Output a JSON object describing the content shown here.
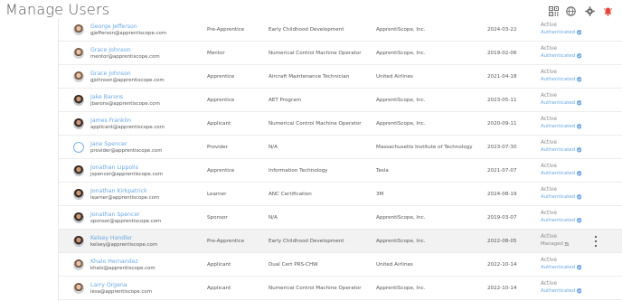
{
  "header": {
    "title": "Manage Users",
    "icons": [
      "qr-code-icon",
      "globe-icon",
      "gear-icon",
      "alarm-bell-icon"
    ],
    "alert_color": "#e5473b"
  },
  "colors": {
    "link": "#6aa8e3",
    "text": "#555555",
    "muted": "#8a8a8a",
    "row_highlight": "#f2f2f2"
  },
  "users": [
    {
      "name": "George Jefferson",
      "email": "gjefferson@apprentiscope.com",
      "role": "Pre-Apprentice",
      "occupation": "Early Childhood Development",
      "organization": "ApprentiScope, Inc.",
      "date": "2024-03-22",
      "status": "Active",
      "auth": "Authenticated",
      "avatar": "photo"
    },
    {
      "name": "Grace Johnson",
      "email": "mentor@apprentiscope.com",
      "role": "Mentor",
      "occupation": "Numerical Control Machine Operator",
      "organization": "ApprentiScope, Inc.",
      "date": "2019-02-06",
      "status": "Active",
      "auth": "Authenticated",
      "avatar": "photo"
    },
    {
      "name": "Grace Johnson",
      "email": "gjohnson@apprentiscope.com",
      "role": "Apprentice",
      "occupation": "Aircraft Maintenance Technician",
      "organization": "United Airlines",
      "date": "2021-04-18",
      "status": "Active",
      "auth": "Authenticated",
      "avatar": "photo"
    },
    {
      "name": "Jake Barons",
      "email": "jbarons@apprentiscope.com",
      "role": "Apprentice",
      "occupation": "AET Program",
      "organization": "ApprentiScope, Inc.",
      "date": "2023-05-11",
      "status": "Active",
      "auth": "Authenticated",
      "avatar": "photo-dark"
    },
    {
      "name": "James Franklin",
      "email": "applicant@apprentiscope.com",
      "role": "Applicant",
      "occupation": "Numerical Control Machine Operator",
      "organization": "ApprentiScope, Inc.",
      "date": "2020-09-11",
      "status": "Active",
      "auth": "Authenticated",
      "avatar": "photo-dark"
    },
    {
      "name": "Jane Spencer",
      "email": "provider@apprentiscope.com",
      "role": "Provider",
      "occupation": "N/A",
      "organization": "Massachusetts Institute of Technology",
      "date": "2023-07-30",
      "status": "Active",
      "auth": "Authenticated",
      "avatar": "placeholder"
    },
    {
      "name": "Jonathan Lippolis",
      "email": "jspencer@apprentiscope.com",
      "role": "Apprentice",
      "occupation": "Information Technology",
      "organization": "Tesla",
      "date": "2021-07-07",
      "status": "Active",
      "auth": "Authenticated",
      "avatar": "photo-dark"
    },
    {
      "name": "Jonathan Kirkpatrick",
      "email": "learner@apprentiscope.com",
      "role": "Learner",
      "occupation": "ANC Certification",
      "organization": "3M",
      "date": "2024-08-19",
      "status": "Active",
      "auth": "Authenticated",
      "avatar": "photo-dark"
    },
    {
      "name": "Jonathan Spencer",
      "email": "sponsor@apprentiscope.com",
      "role": "Sponsor",
      "occupation": "N/A",
      "organization": "ApprentiScope, Inc.",
      "date": "2019-03-07",
      "status": "Active",
      "auth": "Authenticated",
      "avatar": "photo-dark"
    },
    {
      "name": "Kelsey Handler",
      "email": "kelsey@apprentiscope.com",
      "role": "Pre-Apprentice",
      "occupation": "Early Childhood Development",
      "organization": "ApprentiScope, Inc.",
      "date": "2022-08-05",
      "status": "Active",
      "auth": "Managed",
      "avatar": "photo-dark"
    },
    {
      "name": "Khalo Hernandez",
      "email": "khalo@apprentiscope.com",
      "role": "Applicant",
      "occupation": "Dual Cert PRS-CHW",
      "organization": "United Airlines",
      "date": "2022-10-14",
      "status": "Active",
      "auth": "Authenticated",
      "avatar": "photo"
    },
    {
      "name": "Larry Orgena",
      "email": "lesa@apprentiscope.com",
      "role": "Applicant",
      "occupation": "Numerical Control Machine Operator",
      "organization": "ApprentiScope, Inc.",
      "date": "2022-10-14",
      "status": "Active",
      "auth": "Authenticated",
      "avatar": "photo"
    }
  ]
}
